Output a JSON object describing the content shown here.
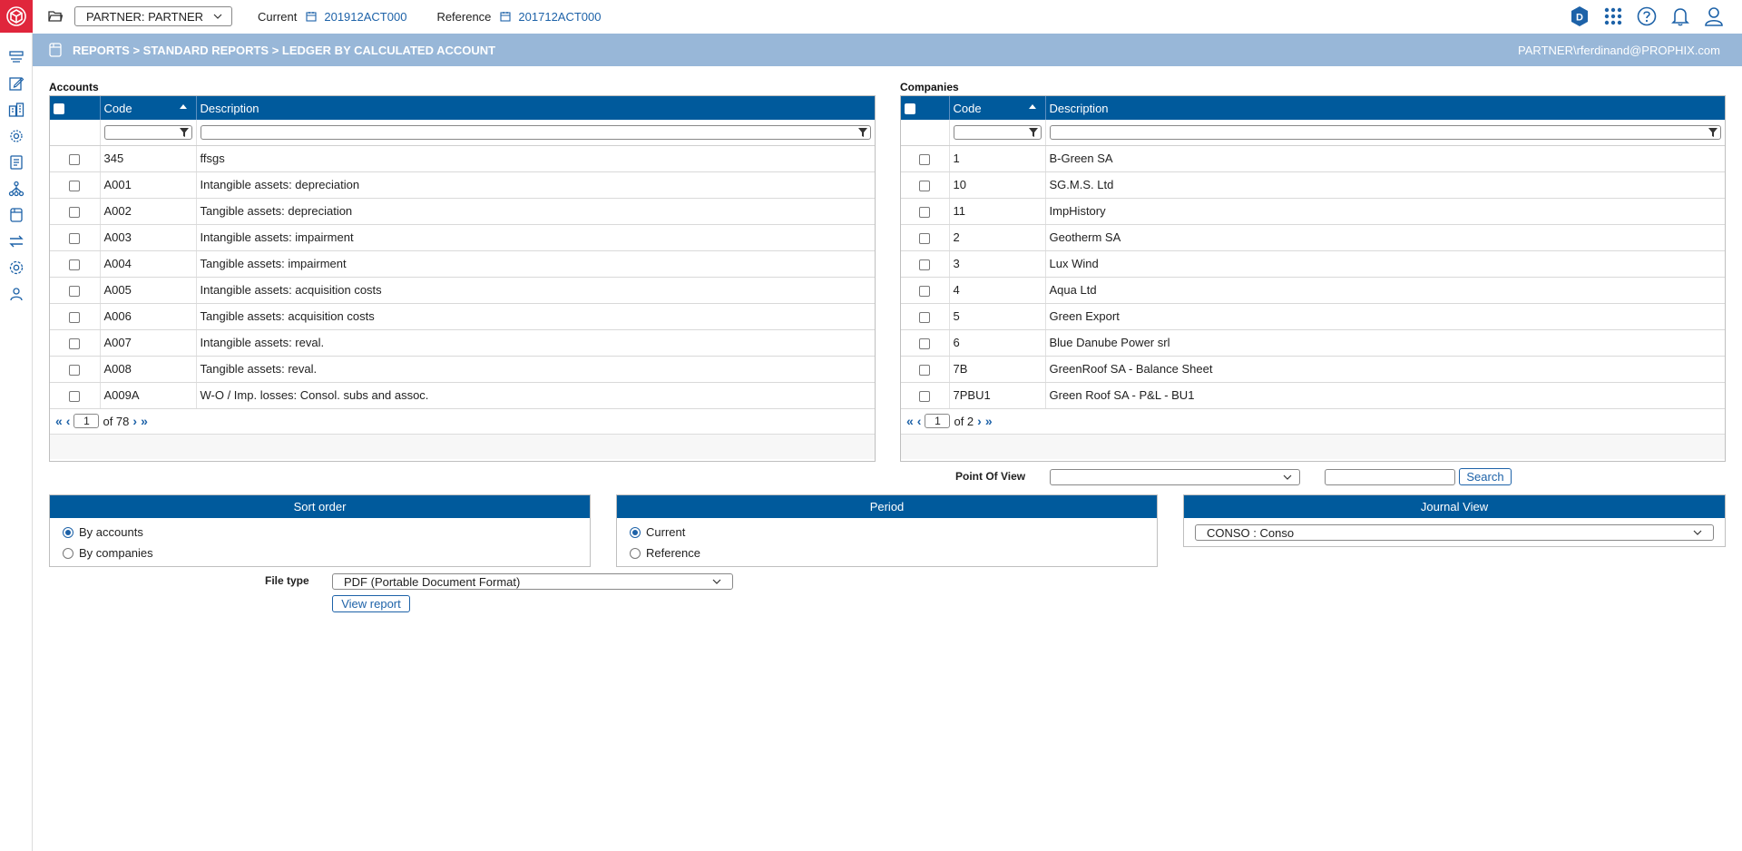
{
  "topbar": {
    "partner_select": "PARTNER: PARTNER",
    "current_label": "Current",
    "current_value": "201912ACT000",
    "reference_label": "Reference",
    "reference_value": "201712ACT000",
    "avatar_letter": "D"
  },
  "banner": {
    "breadcrumb": "REPORTS > STANDARD REPORTS > LEDGER BY CALCULATED ACCOUNT",
    "user": "PARTNER\\rferdinand@PROPHIX.com"
  },
  "accounts": {
    "title": "Accounts",
    "col_code": "Code",
    "col_description": "Description",
    "rows": [
      {
        "code": "345",
        "description": "ffsgs"
      },
      {
        "code": "A001",
        "description": "Intangible assets: depreciation"
      },
      {
        "code": "A002",
        "description": "Tangible assets: depreciation"
      },
      {
        "code": "A003",
        "description": "Intangible assets: impairment"
      },
      {
        "code": "A004",
        "description": "Tangible assets: impairment"
      },
      {
        "code": "A005",
        "description": "Intangible assets: acquisition costs"
      },
      {
        "code": "A006",
        "description": "Tangible assets: acquisition costs"
      },
      {
        "code": "A007",
        "description": "Intangible assets: reval."
      },
      {
        "code": "A008",
        "description": "Tangible assets: reval."
      },
      {
        "code": "A009A",
        "description": "W-O / Imp. losses: Consol. subs and assoc."
      }
    ],
    "pager": {
      "page": "1",
      "of_label": "of 78"
    }
  },
  "companies": {
    "title": "Companies",
    "col_code": "Code",
    "col_description": "Description",
    "rows": [
      {
        "code": "1",
        "description": "B-Green SA"
      },
      {
        "code": "10",
        "description": "SG.M.S. Ltd"
      },
      {
        "code": "11",
        "description": "ImpHistory"
      },
      {
        "code": "2",
        "description": "Geotherm SA"
      },
      {
        "code": "3",
        "description": "Lux Wind"
      },
      {
        "code": "4",
        "description": "Aqua Ltd"
      },
      {
        "code": "5",
        "description": "Green Export"
      },
      {
        "code": "6",
        "description": "Blue Danube Power srl"
      },
      {
        "code": "7B",
        "description": "GreenRoof SA - Balance Sheet"
      },
      {
        "code": "7PBU1",
        "description": "Green Roof SA - P&L - BU1"
      }
    ],
    "pager": {
      "page": "1",
      "of_label": "of 2"
    }
  },
  "pov": {
    "label": "Point Of View",
    "search_button": "Search"
  },
  "sort_order": {
    "title": "Sort order",
    "options": [
      "By accounts",
      "By companies"
    ],
    "selected": 0
  },
  "period": {
    "title": "Period",
    "options": [
      "Current",
      "Reference"
    ],
    "selected": 0
  },
  "journal_view": {
    "title": "Journal View",
    "value": "CONSO : Conso"
  },
  "file_type": {
    "label": "File type",
    "value": "PDF (Portable Document Format)",
    "view_button": "View report"
  },
  "colors": {
    "header_blue": "#005a9c",
    "banner_blue": "#98b7d8",
    "link_blue": "#1d62a8",
    "logo_red": "#e0263c"
  }
}
